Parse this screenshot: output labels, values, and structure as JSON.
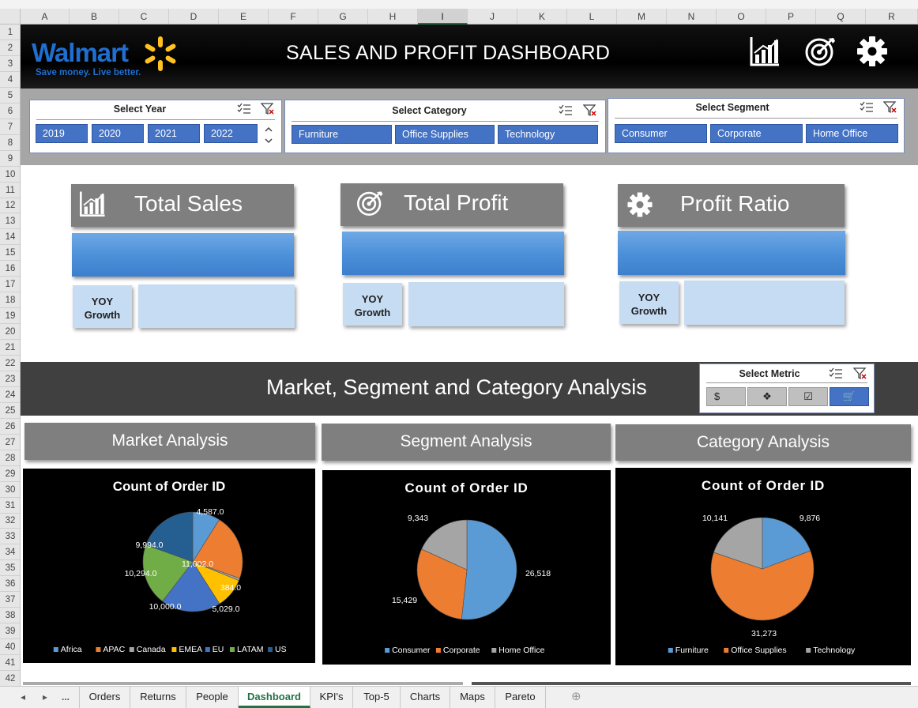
{
  "columns": [
    "A",
    "B",
    "C",
    "D",
    "E",
    "F",
    "G",
    "H",
    "I",
    "J",
    "K",
    "L",
    "M",
    "N",
    "O",
    "P",
    "Q",
    "R"
  ],
  "selected_column": "I",
  "rows": [
    "1",
    "2",
    "3",
    "4",
    "5",
    "6",
    "7",
    "8",
    "9",
    "10",
    "11",
    "12",
    "13",
    "14",
    "15",
    "16",
    "17",
    "18",
    "19",
    "20",
    "21",
    "22",
    "23",
    "24",
    "25",
    "26",
    "27",
    "28",
    "29",
    "30",
    "31",
    "32",
    "33",
    "34",
    "35",
    "36",
    "37",
    "38",
    "39",
    "40",
    "41",
    "42"
  ],
  "header": {
    "logo_word": "Walmart",
    "logo_tagline": "Save money. Live better.",
    "title": "SALES AND PROFIT DASHBOARD",
    "icons": [
      "bar-chart-icon",
      "target-icon",
      "gear-icon"
    ]
  },
  "slicers": {
    "year": {
      "title": "Select Year",
      "items": [
        "2019",
        "2020",
        "2021",
        "2022"
      ]
    },
    "category": {
      "title": "Select Category",
      "items": [
        "Furniture",
        "Office Supplies",
        "Technology"
      ]
    },
    "segment": {
      "title": "Select Segment",
      "items": [
        "Consumer",
        "Corporate",
        "Home Office"
      ]
    }
  },
  "kpis": [
    {
      "title": "Total Sales",
      "icon": "bar-chart-icon",
      "yoy_label_1": "YOY",
      "yoy_label_2": "Growth"
    },
    {
      "title": "Total Profit",
      "icon": "target-icon",
      "yoy_label_1": "YOY",
      "yoy_label_2": "Growth"
    },
    {
      "title": "Profit Ratio",
      "icon": "gear-icon",
      "yoy_label_1": "YOY",
      "yoy_label_2": "Growth"
    }
  ],
  "analysis": {
    "section_title": "Market, Segment and Category Analysis",
    "metric_slicer": {
      "title": "Select Metric",
      "buttons": [
        "$",
        "❖",
        "☑",
        "🛒"
      ],
      "selected_index": 3
    },
    "market_title": "Market Analysis",
    "segment_title": "Segment Analysis",
    "category_title": "Category Analysis"
  },
  "colors": {
    "blue": "#5b9bd5",
    "orange": "#ed7d31",
    "grey": "#a5a5a5",
    "gold": "#ffc000",
    "darkblue": "#4472c4",
    "green": "#70ad47",
    "navy": "#255e91",
    "accent": "#4472c4"
  },
  "chart_data": [
    {
      "type": "pie",
      "title": "Count of Order ID",
      "categories": [
        "Africa",
        "APAC",
        "Canada",
        "EMEA",
        "EU",
        "LATAM",
        "US"
      ],
      "values": [
        4587,
        11002,
        384,
        5029,
        10000,
        10294,
        9994
      ],
      "labels": [
        "4,587.0",
        "11,002.0",
        "384.0",
        "5,029.0",
        "10,000.0",
        "10,294.0",
        "9,994.0"
      ],
      "colors": [
        "#5b9bd5",
        "#ed7d31",
        "#a5a5a5",
        "#ffc000",
        "#4472c4",
        "#70ad47",
        "#255e91"
      ],
      "legend": "bottom"
    },
    {
      "type": "pie",
      "title": "Count of Order ID",
      "categories": [
        "Consumer",
        "Corporate",
        "Home Office"
      ],
      "values": [
        26518,
        15429,
        9343
      ],
      "labels": [
        "26,518",
        "15,429",
        "9,343"
      ],
      "colors": [
        "#5b9bd5",
        "#ed7d31",
        "#a5a5a5"
      ],
      "legend": "bottom"
    },
    {
      "type": "pie",
      "title": "Count of Order ID",
      "categories": [
        "Furniture",
        "Office Supplies",
        "Technology"
      ],
      "values": [
        9876,
        31273,
        10141
      ],
      "labels": [
        "9,876",
        "31,273",
        "10,141"
      ],
      "colors": [
        "#5b9bd5",
        "#ed7d31",
        "#a5a5a5"
      ],
      "legend": "bottom"
    }
  ],
  "sheet_tabs": {
    "ellipsis": "...",
    "tabs": [
      "Orders",
      "Returns",
      "People",
      "Dashboard",
      "KPI's",
      "Top-5",
      "Charts",
      "Maps",
      "Pareto"
    ],
    "active": "Dashboard",
    "add_symbol": "⊕"
  }
}
